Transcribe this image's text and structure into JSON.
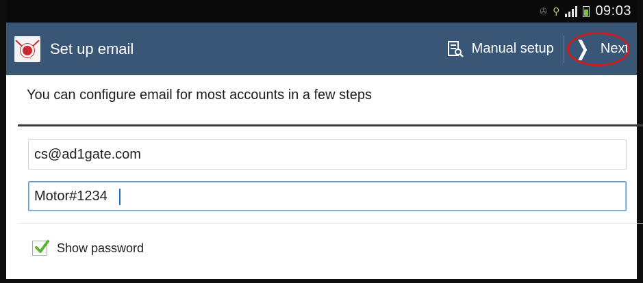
{
  "status_bar": {
    "time": "09:03",
    "icons": [
      "notification-icon",
      "usb-icon",
      "signal-icon",
      "battery-icon"
    ]
  },
  "action_bar": {
    "title": "Set up email",
    "manual_setup_label": "Manual setup",
    "next_label": "Next",
    "colors": {
      "background": "#3a5677",
      "highlight_ring": "#d01c20"
    }
  },
  "form": {
    "intro_text": "You can configure email for most accounts in a few steps",
    "email_value": "cs@ad1gate.com",
    "password_value": "Motor#1234",
    "show_password_label": "Show password",
    "show_password_checked": true
  }
}
